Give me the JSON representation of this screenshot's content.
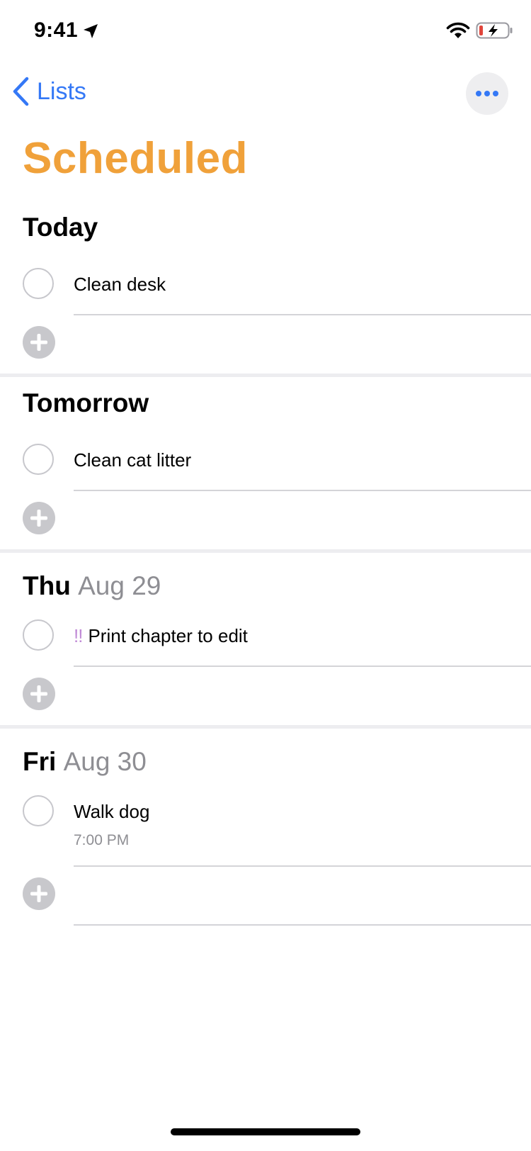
{
  "status_bar": {
    "time": "9:41"
  },
  "nav": {
    "back_label": "Lists"
  },
  "page": {
    "title": "Scheduled"
  },
  "sections": [
    {
      "header": "Today",
      "date": "",
      "items": [
        {
          "title": "Clean desk",
          "priority": "",
          "subtitle": ""
        }
      ]
    },
    {
      "header": "Tomorrow",
      "date": "",
      "items": [
        {
          "title": "Clean cat litter",
          "priority": "",
          "subtitle": ""
        }
      ]
    },
    {
      "header": "Thu",
      "date": "Aug 29",
      "items": [
        {
          "title": "Print chapter to edit",
          "priority": "!!",
          "subtitle": ""
        }
      ]
    },
    {
      "header": "Fri",
      "date": "Aug 30",
      "items": [
        {
          "title": "Walk dog",
          "priority": "",
          "subtitle": "7:00 PM"
        }
      ]
    }
  ],
  "colors": {
    "accent_blue": "#3478f6",
    "title_orange": "#f0a13a",
    "priority_purple": "#c08ad6",
    "secondary_gray": "#8e8e93"
  }
}
